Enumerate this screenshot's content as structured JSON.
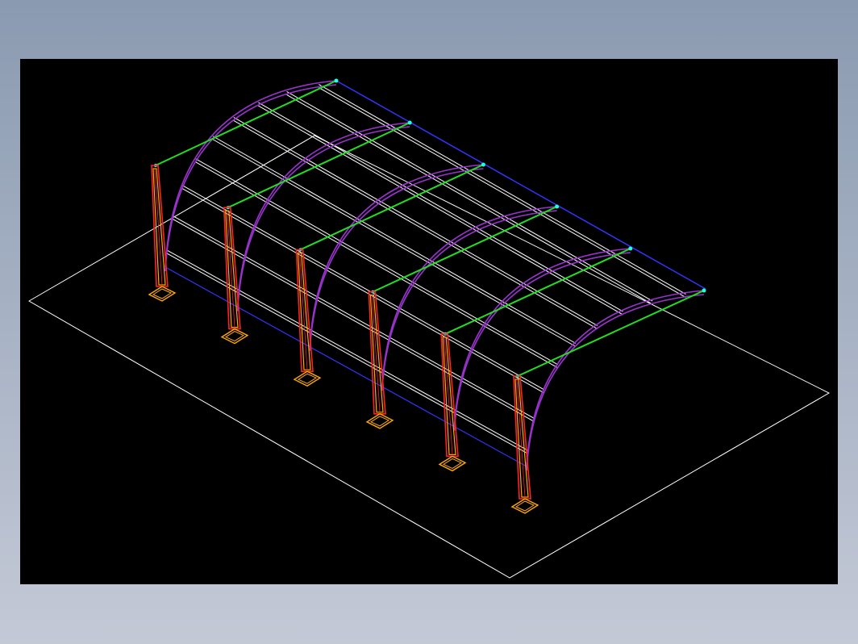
{
  "viewport": {
    "background": "#000000"
  },
  "colors": {
    "ground_outline": "#ffffff",
    "purlin": "#ffffff",
    "cable": "#22dd22",
    "cable_anchor": "#22ffdd",
    "arch_rib": "#9933cc",
    "roof_edge": "#3333ff",
    "column_outer": "#ff2222",
    "column_inner": "#ffaa00",
    "base_plate": "#ffaa00"
  },
  "structure": {
    "frame_count": 6,
    "purlin_count": 9,
    "components": [
      "ground-outline",
      "purlins",
      "arch-ribs",
      "tension-cables",
      "columns",
      "base-plates"
    ]
  }
}
